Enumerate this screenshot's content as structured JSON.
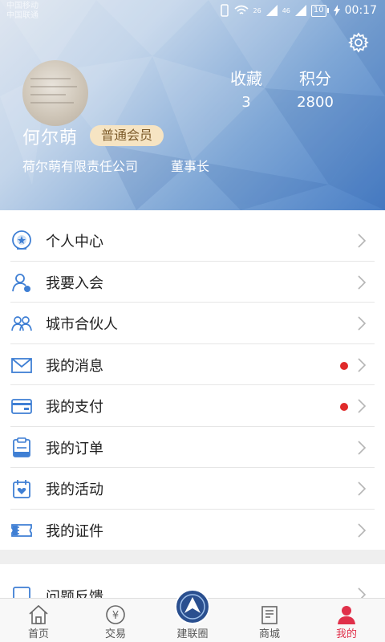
{
  "status_bar": {
    "carrier_1": "中国移动",
    "carrier_2": "中国联通",
    "signal_1": "26",
    "signal_2": "46",
    "battery": "10",
    "time": "00:17"
  },
  "profile": {
    "name": "何尔萌",
    "member_badge": "普通会员",
    "company": "荷尔萌有限责任公司",
    "position": "董事长",
    "stats": {
      "favorites_label": "收藏",
      "favorites_value": "3",
      "points_label": "积分",
      "points_value": "2800"
    }
  },
  "menu": {
    "items": [
      {
        "label": "个人中心",
        "icon": "personal-center-icon",
        "dot": false
      },
      {
        "label": "我要入会",
        "icon": "join-icon",
        "dot": false
      },
      {
        "label": "城市合伙人",
        "icon": "partner-icon",
        "dot": false
      },
      {
        "label": "我的消息",
        "icon": "message-icon",
        "dot": true
      },
      {
        "label": "我的支付",
        "icon": "payment-icon",
        "dot": true
      },
      {
        "label": "我的订单",
        "icon": "order-icon",
        "dot": false
      },
      {
        "label": "我的活动",
        "icon": "activity-icon",
        "dot": false
      },
      {
        "label": "我的证件",
        "icon": "certificate-icon",
        "dot": false
      }
    ],
    "feedback_label": "问题反馈"
  },
  "tabbar": {
    "tabs": [
      {
        "label": "首页",
        "icon": "home-icon"
      },
      {
        "label": "交易",
        "icon": "trade-icon"
      },
      {
        "label": "建联圈",
        "icon": "circle-logo-icon"
      },
      {
        "label": "商城",
        "icon": "mall-icon"
      },
      {
        "label": "我的",
        "icon": "profile-icon"
      }
    ],
    "active_index": 4
  },
  "colors": {
    "accent_blue": "#3f7fd4",
    "active_tab": "#e0304a",
    "badge_bg": "#f6e4c3",
    "dot_red": "#e02a2a"
  }
}
